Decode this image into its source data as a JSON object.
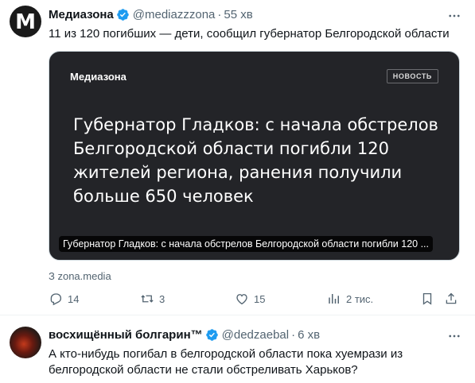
{
  "tweet1": {
    "avatar_letter": "M",
    "name": "Медиазона",
    "handle": "@mediazzzona",
    "dot": "·",
    "time": "55 хв",
    "text": "11 из 120 погибших — дети, сообщил губернатор Белгородской области",
    "card": {
      "brand": "Медиазона",
      "tag": "НОВОСТЬ",
      "headline": "Губернатор Гладков: с начала обстрелов Белгородской области погибли 120 жителей региона, ранения получили больше 650 человек",
      "caption": "Губернатор Гладков: с начала обстрелов Белгородской области погибли 120 ..."
    },
    "source": "З zona.media",
    "actions": {
      "replies": "14",
      "retweets": "3",
      "likes": "15",
      "views": "2 тис."
    }
  },
  "tweet2": {
    "name": "восхищённый болгарин™",
    "handle": "@dedzaebal",
    "dot": "·",
    "time": "6 хв",
    "text_line1": "А кто-нибудь погибал в белгородской области пока хуемрази из",
    "text_line2": "белгородской области не стали обстреливать Харьков?"
  },
  "colors": {
    "verified": "#1d9bf0",
    "secondary_text": "#536471",
    "card_bg": "#232428"
  },
  "icons": [
    "more-icon",
    "reply-icon",
    "retweet-icon",
    "like-icon",
    "views-icon",
    "bookmark-icon",
    "share-icon",
    "verified-badge-icon"
  ]
}
